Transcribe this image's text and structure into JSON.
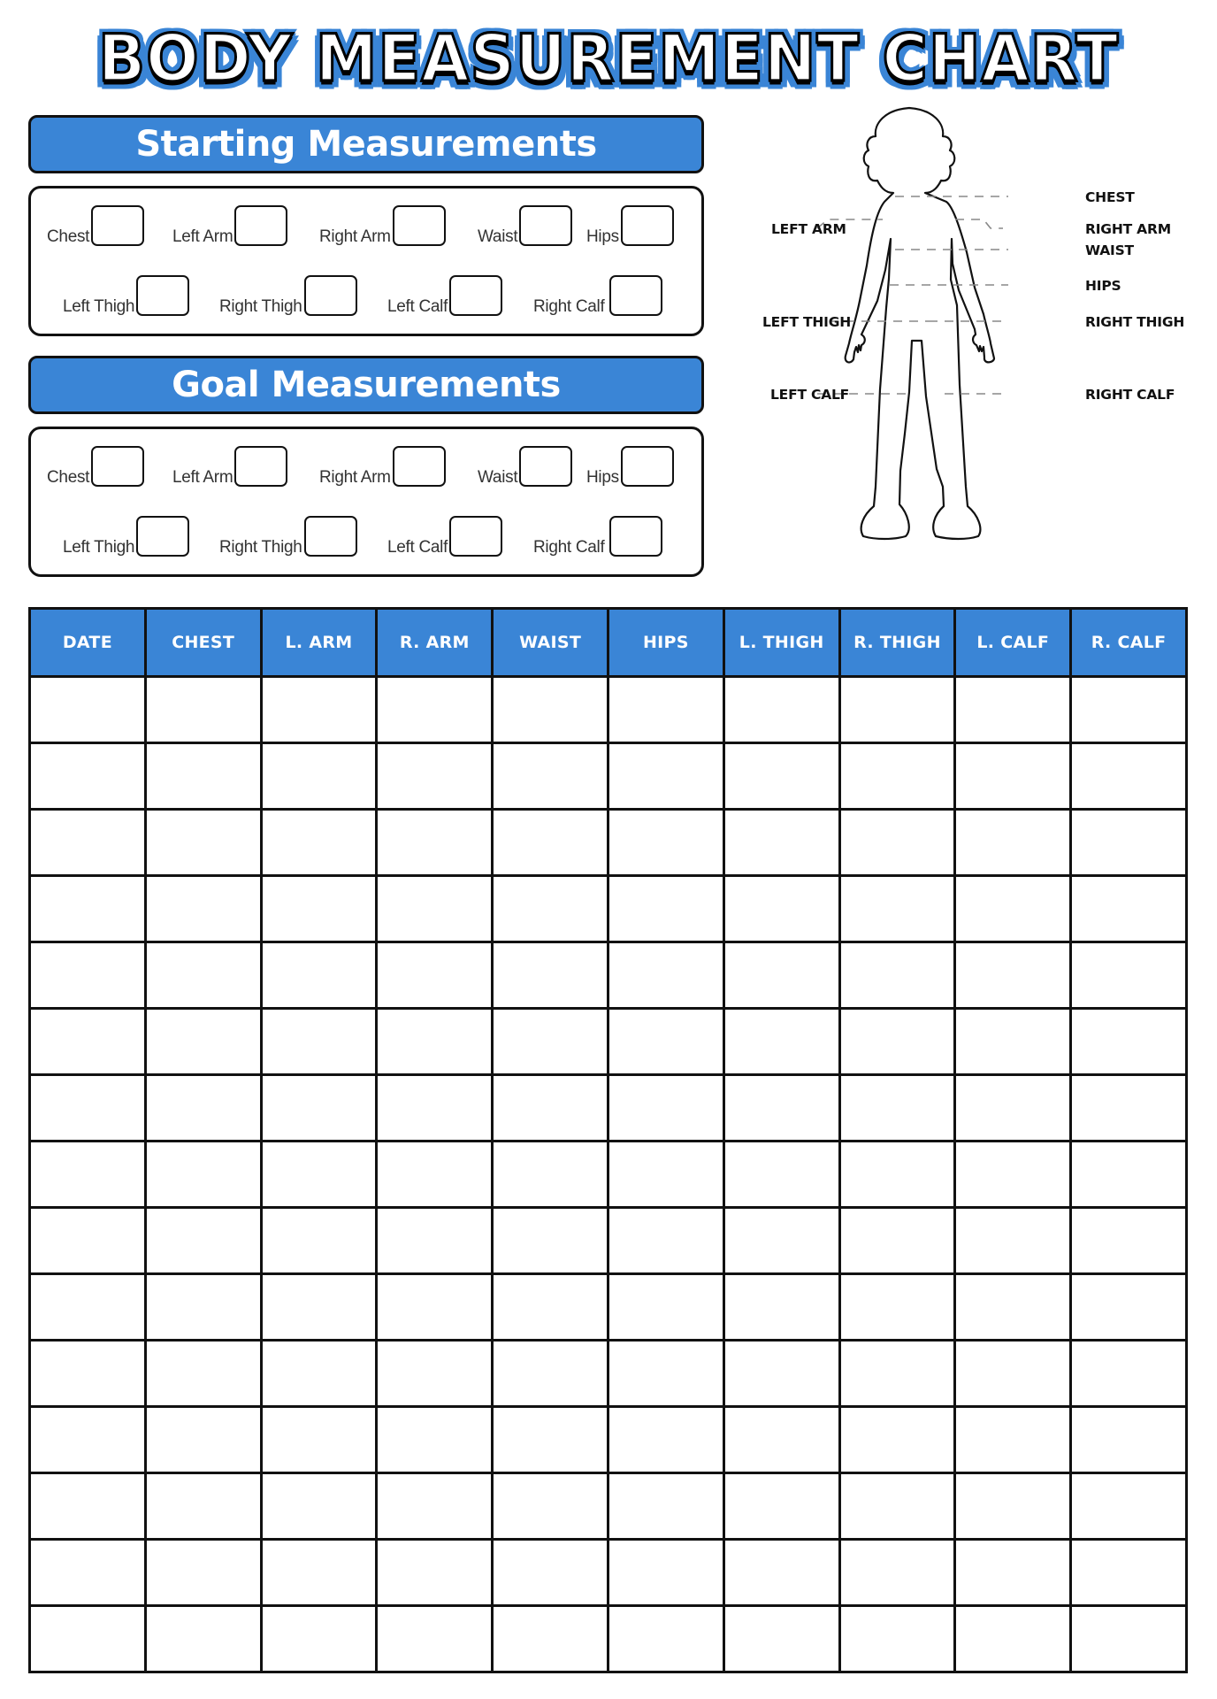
{
  "title": "BODY MEASUREMENT CHART",
  "colors": {
    "accent": "#3a85d6",
    "outline": "#111111",
    "background": "#ffffff"
  },
  "sections": [
    {
      "title": "Starting Measurements",
      "fields": [
        {
          "label": "Chest",
          "value": ""
        },
        {
          "label": "Left Arm",
          "value": ""
        },
        {
          "label": "Right Arm",
          "value": ""
        },
        {
          "label": "Waist",
          "value": ""
        },
        {
          "label": "Hips",
          "value": ""
        },
        {
          "label": "Left Thigh",
          "value": ""
        },
        {
          "label": "Right Thigh",
          "value": ""
        },
        {
          "label": "Left Calf",
          "value": ""
        },
        {
          "label": "Right Calf",
          "value": ""
        }
      ]
    },
    {
      "title": "Goal Measurements",
      "fields": [
        {
          "label": "Chest",
          "value": ""
        },
        {
          "label": "Left Arm",
          "value": ""
        },
        {
          "label": "Right Arm",
          "value": ""
        },
        {
          "label": "Waist",
          "value": ""
        },
        {
          "label": "Hips",
          "value": ""
        },
        {
          "label": "Left Thigh",
          "value": ""
        },
        {
          "label": "Right Thigh",
          "value": ""
        },
        {
          "label": "Left Calf",
          "value": ""
        },
        {
          "label": "Right Calf",
          "value": ""
        }
      ]
    }
  ],
  "figure": {
    "icon": "body-outline-icon",
    "labels": {
      "chest": "CHEST",
      "left_arm": "LEFT ARM",
      "right_arm": "RIGHT ARM",
      "waist": "WAIST",
      "hips": "HIPS",
      "left_thigh": "LEFT THIGH",
      "right_thigh": "RIGHT THIGH",
      "left_calf": "LEFT CALF",
      "right_calf": "RIGHT CALF"
    }
  },
  "table": {
    "columns": [
      "DATE",
      "CHEST",
      "L. ARM",
      "R. ARM",
      "WAIST",
      "HIPS",
      "L. THIGH",
      "R. THIGH",
      "L. CALF",
      "R. CALF"
    ],
    "row_count": 15,
    "rows": []
  }
}
